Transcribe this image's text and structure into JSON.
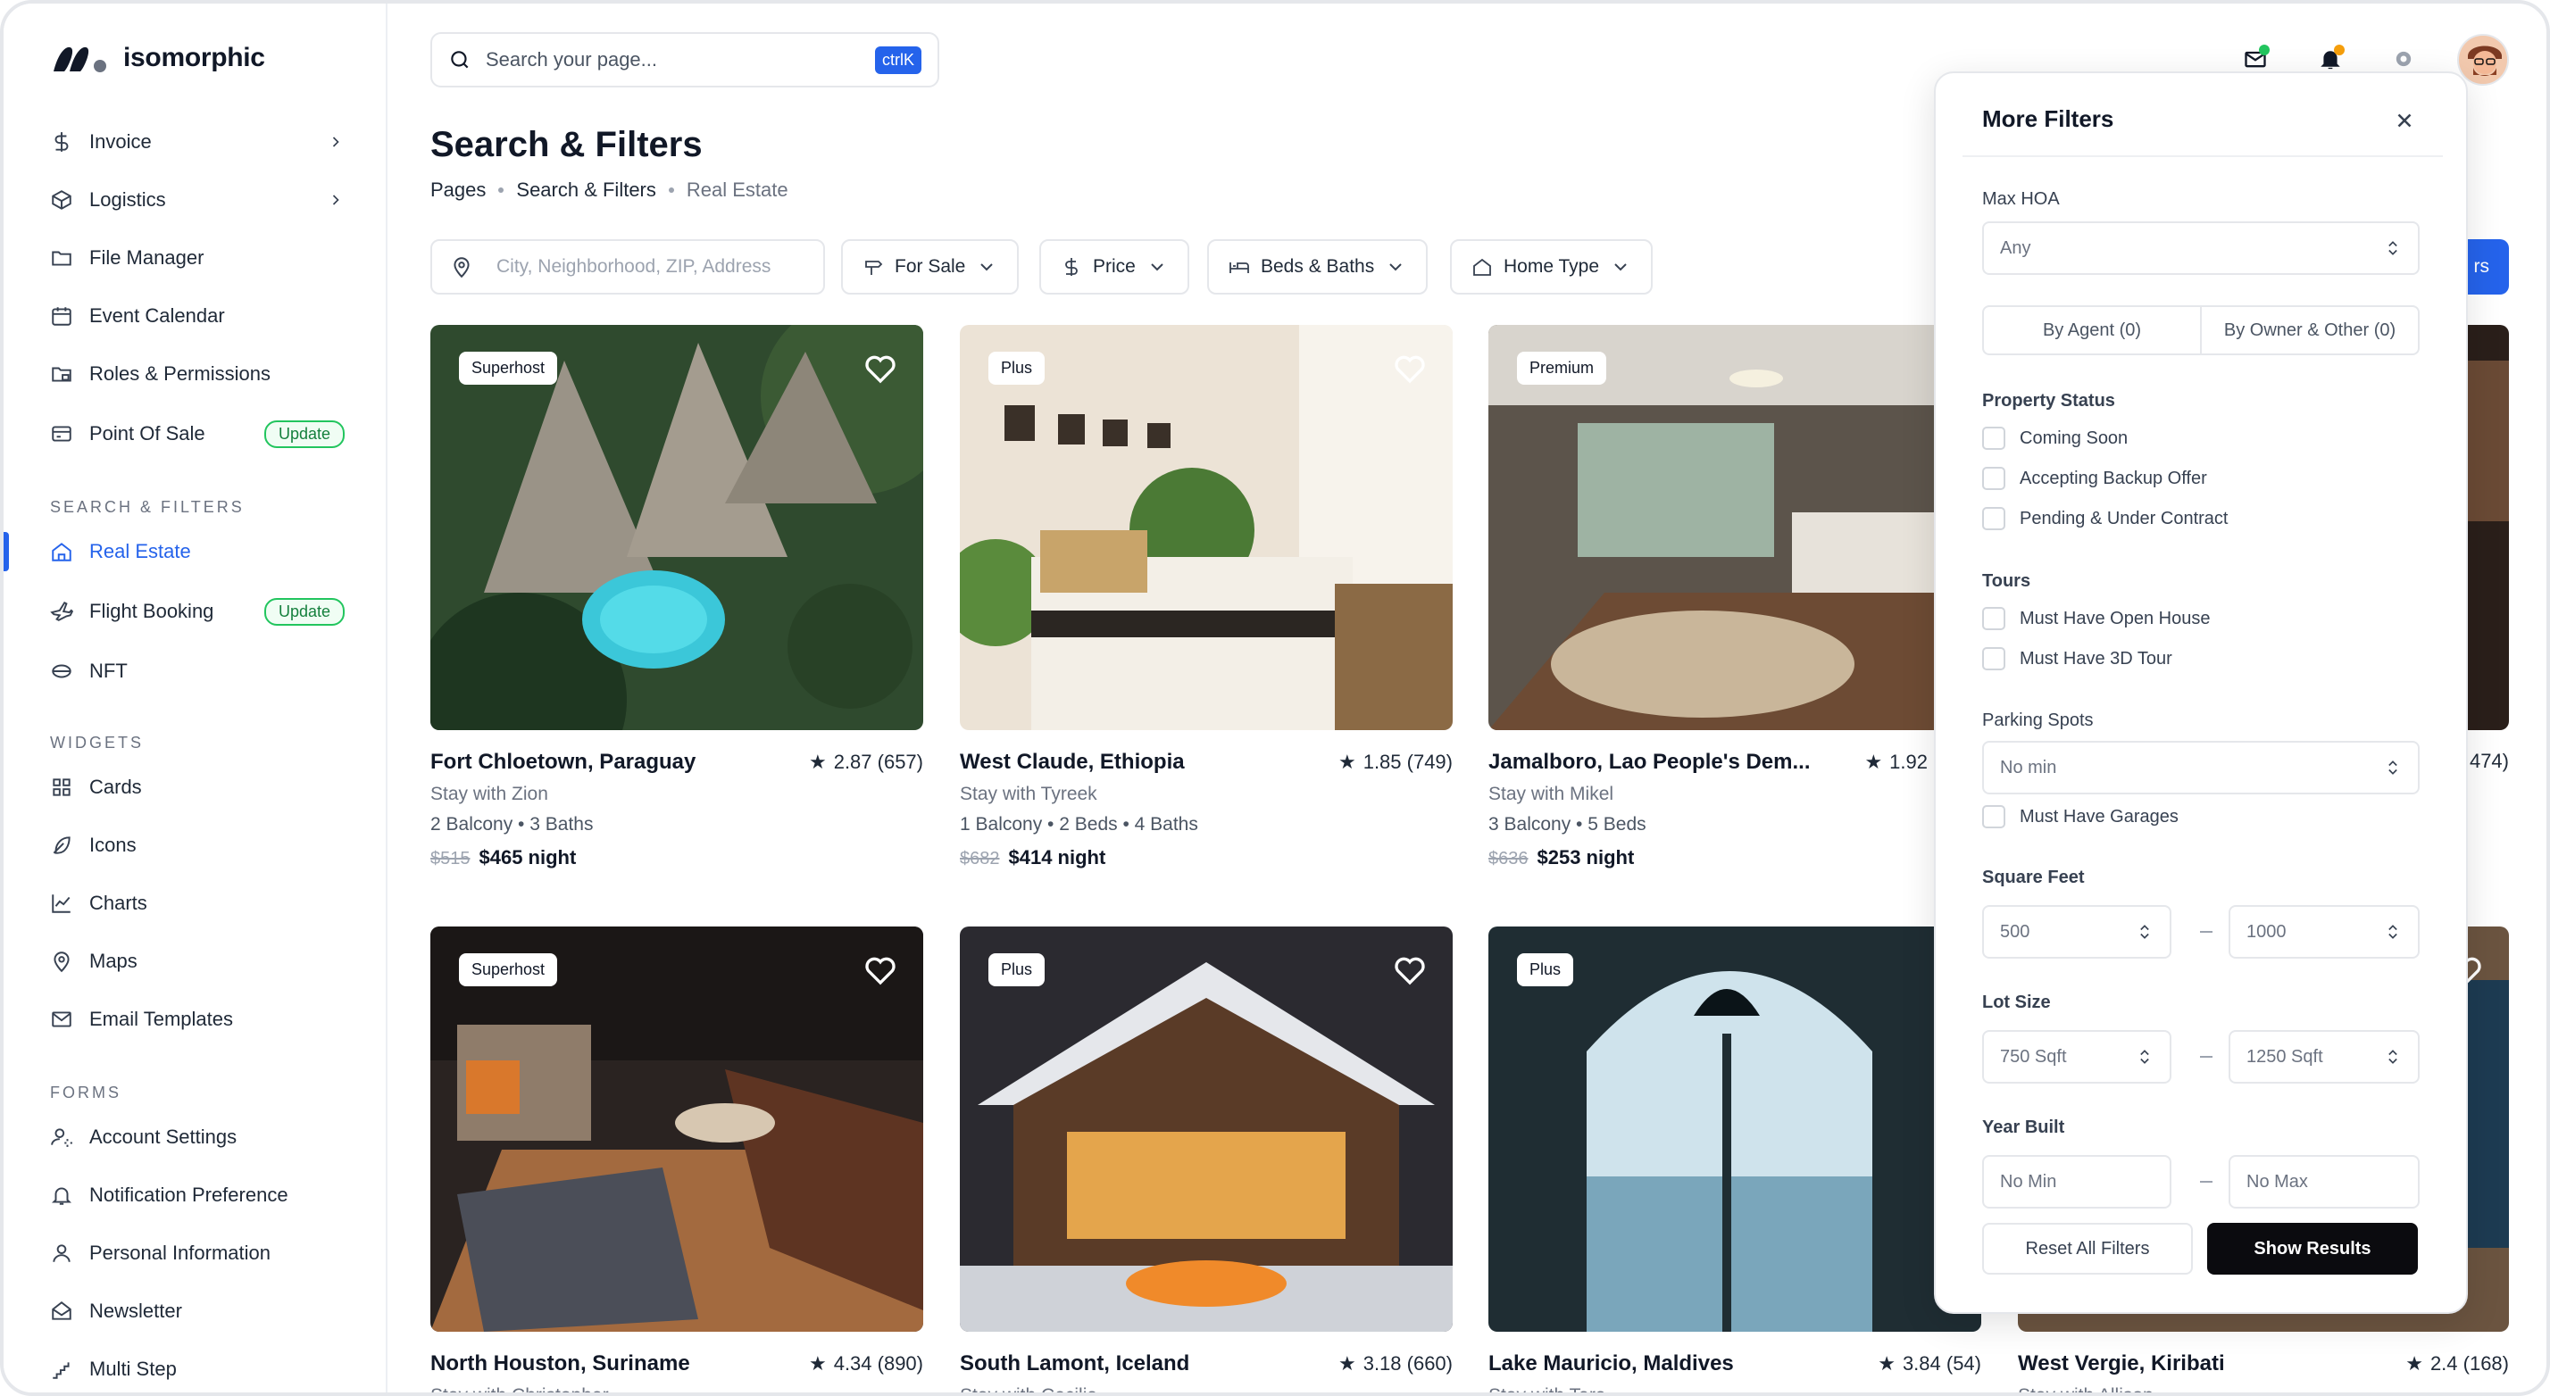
{
  "app": {
    "name": "isomorphic"
  },
  "search": {
    "placeholder": "Search your page...",
    "shortcut": "ctrlK"
  },
  "sidebar": {
    "items_top": [
      {
        "label": "Invoice",
        "icon": "dollar-icon",
        "chevron": true
      },
      {
        "label": "Logistics",
        "icon": "box-icon",
        "chevron": true
      },
      {
        "label": "File Manager",
        "icon": "folder-icon"
      },
      {
        "label": "Event Calendar",
        "icon": "calendar-icon"
      },
      {
        "label": "Roles & Permissions",
        "icon": "folder-lock-icon"
      },
      {
        "label": "Point Of Sale",
        "icon": "pos-icon",
        "badge": "Update"
      }
    ],
    "section_search": "SEARCH & FILTERS",
    "items_search": [
      {
        "label": "Real Estate",
        "icon": "home-icon",
        "active": true
      },
      {
        "label": "Flight Booking",
        "icon": "plane-icon",
        "badge": "Update"
      },
      {
        "label": "NFT",
        "icon": "nft-icon"
      }
    ],
    "section_widgets": "WIDGETS",
    "items_widgets": [
      {
        "label": "Cards",
        "icon": "grid-icon"
      },
      {
        "label": "Icons",
        "icon": "feather-icon"
      },
      {
        "label": "Charts",
        "icon": "chart-icon"
      },
      {
        "label": "Maps",
        "icon": "map-pin-icon"
      },
      {
        "label": "Email Templates",
        "icon": "mail-icon"
      }
    ],
    "section_forms": "FORMS",
    "items_forms": [
      {
        "label": "Account Settings",
        "icon": "user-gear-icon"
      },
      {
        "label": "Notification Preference",
        "icon": "bell-icon"
      },
      {
        "label": "Personal Information",
        "icon": "user-icon"
      },
      {
        "label": "Newsletter",
        "icon": "envelope-open-icon"
      },
      {
        "label": "Multi Step",
        "icon": "steps-icon"
      }
    ]
  },
  "page": {
    "title": "Search & Filters",
    "breadcrumb": [
      "Pages",
      "Search & Filters",
      "Real Estate"
    ]
  },
  "filters": {
    "location_placeholder": "City, Neighborhood, ZIP, Address",
    "for_sale": "For Sale",
    "price": "Price",
    "beds_baths": "Beds & Baths",
    "home_type": "Home Type",
    "more_btn_partial": "rs"
  },
  "listings": [
    {
      "tag": "Superhost",
      "title": "Fort Chloetown, Paraguay",
      "rating": "2.87 (657)",
      "host": "Stay with Zion",
      "features": "2 Balcony • 3 Baths",
      "old_price": "$515",
      "price": "$465 night"
    },
    {
      "tag": "Plus",
      "title": "West Claude, Ethiopia",
      "rating": "1.85 (749)",
      "host": "Stay with Tyreek",
      "features": "1 Balcony • 2 Beds • 4 Baths",
      "old_price": "$682",
      "price": "$414 night"
    },
    {
      "tag": "Premium",
      "title": "Jamalboro, Lao People's Dem...",
      "rating": "1.92",
      "host": "Stay with Mikel",
      "features": "3 Balcony • 5 Beds",
      "old_price": "$636",
      "price": "$253 night"
    },
    {
      "tag": "",
      "title": "",
      "rating": "474)",
      "host": "",
      "features": "",
      "old_price": "",
      "price": ""
    },
    {
      "tag": "Superhost",
      "title": "North Houston, Suriname",
      "rating": "4.34 (890)",
      "host": "Stay with Christopher"
    },
    {
      "tag": "Plus",
      "title": "South Lamont, Iceland",
      "rating": "3.18 (660)",
      "host": "Stay with Cecilia"
    },
    {
      "tag": "Plus",
      "title": "Lake Mauricio, Maldives",
      "rating": "3.84 (54)",
      "host": "Stay with Tara"
    },
    {
      "tag": "",
      "title": "West Vergie, Kiribati",
      "rating": "2.4 (168)",
      "host": "Stay with Allison"
    }
  ],
  "panel": {
    "title": "More Filters",
    "max_hoa_label": "Max HOA",
    "max_hoa_value": "Any",
    "seg": [
      "By Agent (0)",
      "By Owner & Other (0)"
    ],
    "property_status_label": "Property Status",
    "property_status": [
      "Coming Soon",
      "Accepting Backup Offer",
      "Pending & Under Contract"
    ],
    "tours_label": "Tours",
    "tours": [
      "Must Have Open House",
      "Must Have 3D Tour"
    ],
    "parking_label": "Parking Spots",
    "parking_value": "No min",
    "garage": "Must Have Garages",
    "sqft_label": "Square Feet",
    "sqft_min": "500",
    "sqft_max": "1000",
    "lot_label": "Lot Size",
    "lot_min": "750 Sqft",
    "lot_max": "1250 Sqft",
    "year_label": "Year Built",
    "year_min_placeholder": "No Min",
    "year_max_placeholder": "No Max",
    "reset": "Reset All Filters",
    "show": "Show Results"
  },
  "colors": {
    "accent": "#2563eb",
    "update_badge": "#22c55e",
    "dark_button": "#0b0b0f"
  }
}
